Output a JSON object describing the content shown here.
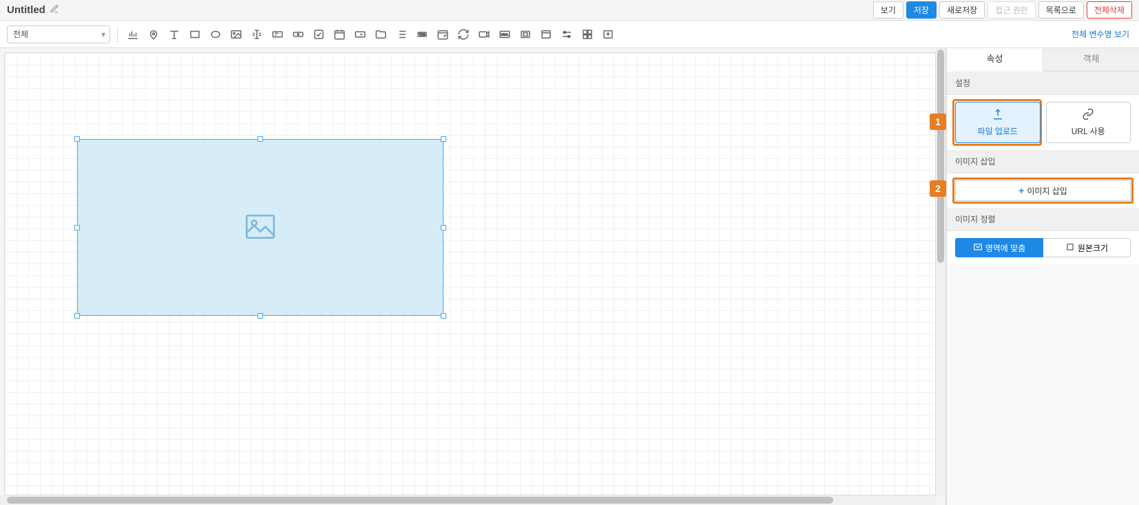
{
  "title": "Untitled",
  "header_buttons": {
    "view": "보기",
    "save": "저장",
    "save_as": "새로저장",
    "access": "접근 권한",
    "to_list": "목록으로",
    "delete_all": "전체삭제"
  },
  "dropdown": {
    "selected": "전체"
  },
  "toolbar_link": "전체 변수명 보기",
  "tabs": {
    "properties": "속성",
    "object": "객체"
  },
  "sections": {
    "settings": "설정",
    "insert_image": "이미지 삽입",
    "image_align": "이미지 정렬"
  },
  "options": {
    "file_upload": "파일 업로드",
    "url_use": "URL 사용"
  },
  "insert_button": "이미지 삽입",
  "align": {
    "fit_area": "영역에 맞춤",
    "original": "원본크기"
  },
  "callouts": {
    "one": "1",
    "two": "2"
  }
}
